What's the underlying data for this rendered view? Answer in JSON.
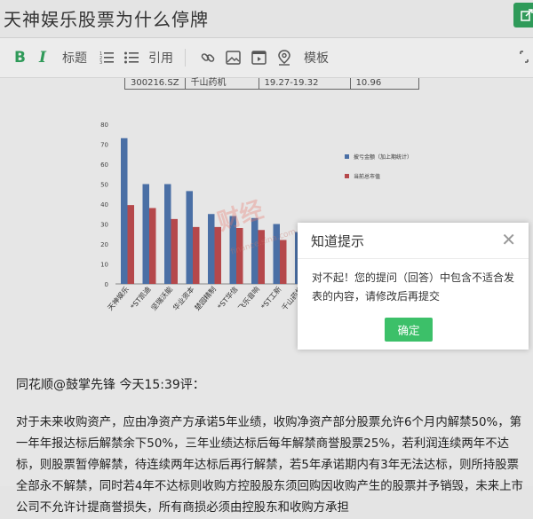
{
  "page": {
    "title": "天神娱乐股票为什么停牌"
  },
  "toolbar": {
    "bold": "B",
    "italic": "I",
    "heading": "标题",
    "quote": "引用",
    "template": "模板"
  },
  "table_fragment": [
    "300216.SZ",
    "千山药机",
    "19.27-19.32",
    "10.96"
  ],
  "chart_data": {
    "type": "bar",
    "categories": [
      "天神娱乐",
      "*ST凯迪",
      "坚瑞沃能",
      "华业资本",
      "楚园精制",
      "*ST华信",
      "飞乐音响",
      "*ST工新",
      "千山药机"
    ],
    "series": [
      {
        "name": "披亏金额（加上期统计）",
        "color": "#4a6fa5",
        "values": [
          73,
          50,
          50,
          46.5,
          35,
          34,
          33,
          30,
          26
        ]
      },
      {
        "name": "当前总市值",
        "color": "#b5484b",
        "values": [
          39.5,
          38,
          32.5,
          28.5,
          28.5,
          28,
          27,
          22,
          21
        ]
      }
    ],
    "ylim": [
      0,
      80
    ],
    "yticks": [
      0,
      10,
      20,
      30,
      40,
      50,
      60,
      70,
      80
    ],
    "grid": false,
    "legend": "right"
  },
  "watermark": "财经",
  "watermark_url": "finance.sina.com.cn",
  "post": {
    "byline": "同花顺@鼓掌先锋 今天15:39评：",
    "paragraph": "对于未来收购资产，应由净资产方承诺5年业绩，收购净资产部分股票允许6个月内解禁50%，第一年年报达标后解禁余下50%，三年业绩达标后每年解禁商誉股票25%，若利润连续两年不达标，则股票暂停解禁，待连续两年达标后再行解禁，若5年承诺期内有3年无法达标，则所持股票全部永不解禁，同时若4年不达标则收购方控股股东须回购因收购产生的股票并予销毁，未来上市公司不允许计提商誉损失，所有商损必须由控股东和收购方承担"
  },
  "dialog": {
    "title": "知道提示",
    "close": "✕",
    "message": "对不起！您的提问（回答）中包含不适合发表的内容，请修改后再提交",
    "confirm": "确定"
  }
}
